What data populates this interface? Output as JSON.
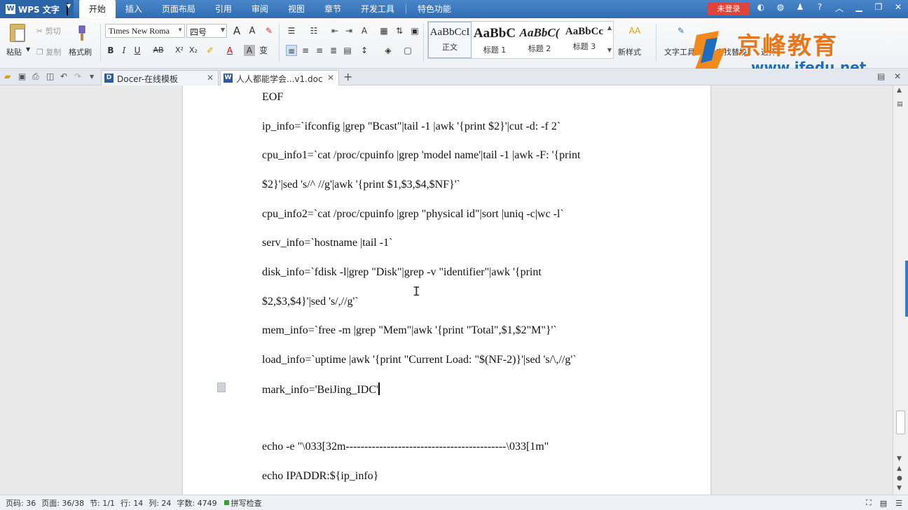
{
  "app": {
    "name": "WPS 文字",
    "login_label": "未登录"
  },
  "menu": {
    "items": [
      "开始",
      "插入",
      "页面布局",
      "引用",
      "审阅",
      "视图",
      "章节",
      "开发工具",
      "特色功能"
    ]
  },
  "ribbon": {
    "paste": "粘贴",
    "cut": "剪切",
    "copy": "复制",
    "format_painter": "格式刷",
    "font_name": "Times New Roma",
    "font_size": "四号",
    "styles": [
      {
        "preview": "AaBbCcI",
        "name": "正文"
      },
      {
        "preview": "AaBbC",
        "name": "标题 1"
      },
      {
        "preview": "AaBbC(",
        "name": "标题 2"
      },
      {
        "preview": "AaBbCc",
        "name": "标题 3"
      }
    ],
    "new_style": "新样式",
    "text_tools": "文字工具",
    "find_replace": "查找替换",
    "select": "选择"
  },
  "watermark": {
    "cn": "京峰教育",
    "url": "www.jfedu.net"
  },
  "tabs": [
    {
      "label": "Docer-在线模板",
      "active": false
    },
    {
      "label": "人人都能学会...v1.doc",
      "active": true
    }
  ],
  "document": {
    "lines": [
      "EOF",
      "ip_info=`ifconfig |grep \"Bcast\"|tail -1 |awk '{print $2}'|cut -d: -f 2`",
      "cpu_info1=`cat /proc/cpuinfo |grep 'model name'|tail -1 |awk -F: '{print",
      "$2}'|sed 's/^ //g'|awk '{print $1,$3,$4,$NF}'`",
      "cpu_info2=`cat /proc/cpuinfo |grep \"physical id\"|sort |uniq -c|wc -l`",
      "serv_info=`hostname |tail -1`",
      "disk_info=`fdisk -l|grep \"Disk\"|grep -v \"identifier\"|awk '{print",
      "$2,$3,$4}'|sed 's/,//g'`",
      "mem_info=`free -m |grep \"Mem\"|awk '{print \"Total\",$1,$2\"M\"}'`",
      "load_info=`uptime |awk '{print \"Current Load: \"$(NF-2)}'|sed 's/\\,//g'`",
      "mark_info='BeiJing_IDC'",
      "",
      "echo -e \"\\033[32m-------------------------------------------\\033[1m\"",
      "echo IPADDR:${ip_info}"
    ]
  },
  "status": {
    "page_num": "页码: 36",
    "pages": "页面: 36/38",
    "section": "节: 1/1",
    "row": "行: 14",
    "col": "列: 24",
    "words": "字数: 4749",
    "spell": "拼写检查"
  }
}
